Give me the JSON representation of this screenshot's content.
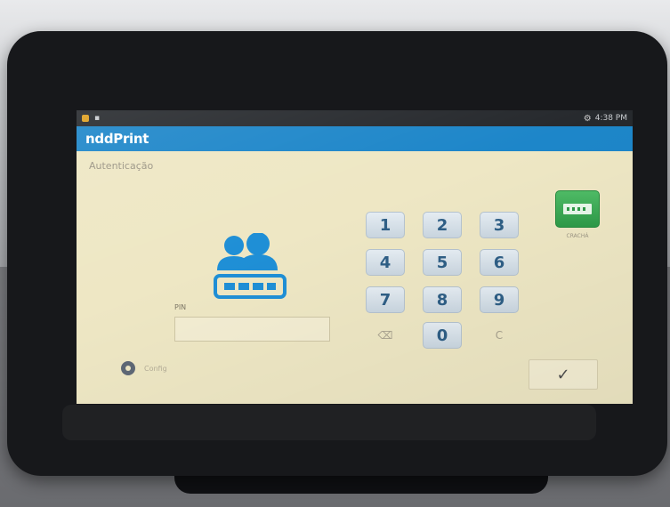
{
  "status_bar": {
    "time": "4:38 PM"
  },
  "app": {
    "logo_prefix": "ndd",
    "logo_suffix": "Print"
  },
  "page": {
    "title": "Autenticação"
  },
  "login": {
    "id_label": "PIN",
    "id_value": ""
  },
  "keypad": {
    "keys": [
      "1",
      "2",
      "3",
      "4",
      "5",
      "6",
      "7",
      "8",
      "9",
      "⌫",
      "0",
      "C"
    ]
  },
  "card_button": {
    "label": "CRACHÁ"
  },
  "footer": {
    "config_label": "Config",
    "confirm_symbol": "✓"
  },
  "colors": {
    "appbar": "#1d86c9",
    "screen_bg": "#eee7c4",
    "key_text": "#2f5f86",
    "card_green": "#2e9a48"
  }
}
